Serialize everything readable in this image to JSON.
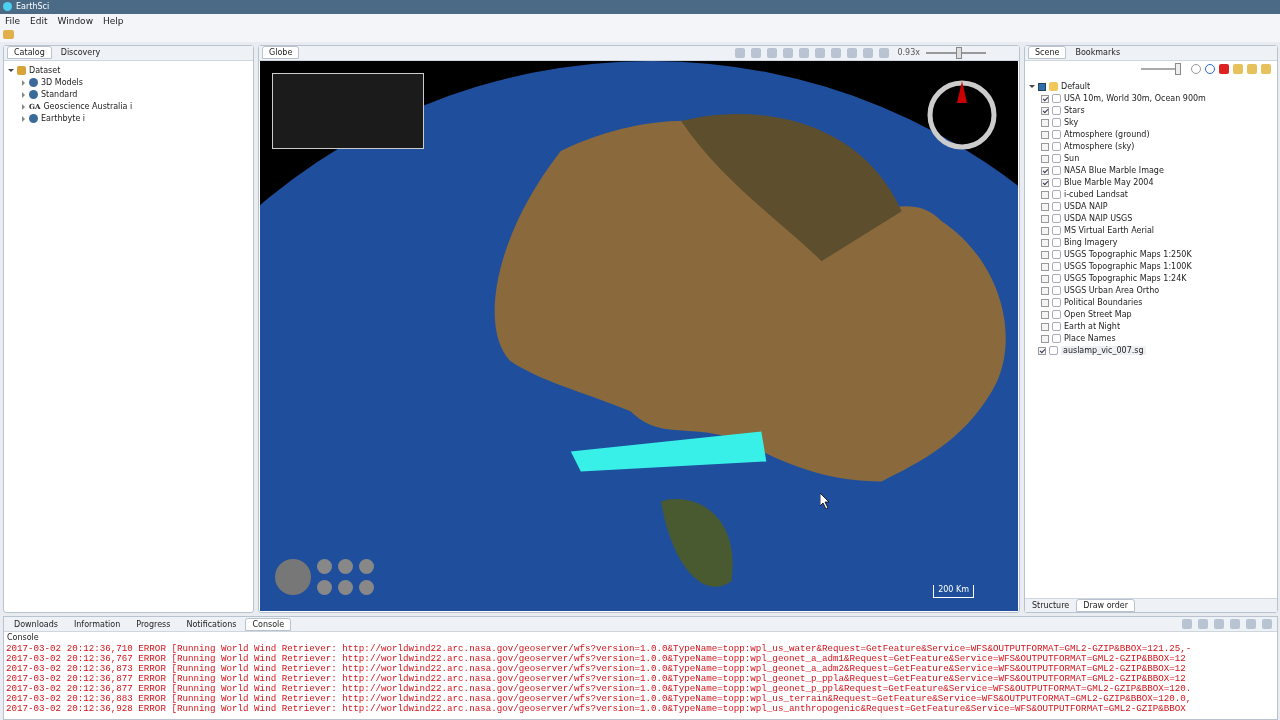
{
  "window": {
    "title": "EarthSci"
  },
  "menu": [
    "File",
    "Edit",
    "Window",
    "Help"
  ],
  "left_panel": {
    "tabs": [
      {
        "label": "Catalog",
        "selected": true
      },
      {
        "label": "Discovery",
        "selected": false
      }
    ],
    "tree": [
      {
        "label": "Dataset",
        "expanded": true,
        "children": [
          {
            "label": "3D Models",
            "expanded": false
          },
          {
            "label": "Standard",
            "expanded": false
          },
          {
            "label": "Geoscience Australia i",
            "expanded": false,
            "prefix": "GA"
          },
          {
            "label": "Earthbyte i",
            "expanded": false
          }
        ]
      }
    ]
  },
  "globe_panel": {
    "tab": {
      "label": "Globe",
      "selected": true
    },
    "zoom_reading": "0.93x",
    "zoom_slider": {
      "level": 0.55
    },
    "scale_label": "200 Km"
  },
  "scene_panel": {
    "tabs": [
      {
        "label": "Scene",
        "selected": true
      },
      {
        "label": "Bookmarks",
        "selected": false
      }
    ],
    "opacity_slider": {
      "level": 1
    },
    "tree": [
      {
        "label": "Default",
        "expanded": true,
        "checked": true,
        "children": [
          {
            "label": "USA 10m, World 30m, Ocean 900m",
            "checked": true
          },
          {
            "label": "Stars",
            "checked": true
          },
          {
            "label": "Sky",
            "checked": false
          },
          {
            "label": "Atmosphere (ground)",
            "checked": false
          },
          {
            "label": "Atmosphere (sky)",
            "checked": false
          },
          {
            "label": "Sun",
            "checked": false
          },
          {
            "label": "NASA Blue Marble Image",
            "checked": true
          },
          {
            "label": "Blue Marble May 2004",
            "checked": true
          },
          {
            "label": "i-cubed Landsat",
            "checked": false
          },
          {
            "label": "USDA NAIP",
            "checked": false
          },
          {
            "label": "USDA NAIP USGS",
            "checked": false
          },
          {
            "label": "MS Virtual Earth Aerial",
            "checked": false
          },
          {
            "label": "Bing Imagery",
            "checked": false
          },
          {
            "label": "USGS Topographic Maps 1:250K",
            "checked": false
          },
          {
            "label": "USGS Topographic Maps 1:100K",
            "checked": false
          },
          {
            "label": "USGS Topographic Maps 1:24K",
            "checked": false
          },
          {
            "label": "USGS Urban Area Ortho",
            "checked": false
          },
          {
            "label": "Political Boundaries",
            "checked": false
          },
          {
            "label": "Open Street Map",
            "checked": false
          },
          {
            "label": "Earth at Night",
            "checked": false
          },
          {
            "label": "Place Names",
            "checked": false
          }
        ]
      },
      {
        "label": "auslamp_vic_007.sg",
        "checked": true
      }
    ],
    "bottom_tabs": [
      {
        "label": "Structure",
        "selected": false
      },
      {
        "label": "Draw order",
        "selected": true
      }
    ]
  },
  "bottom_panel": {
    "tabs": [
      {
        "label": "Downloads",
        "selected": false
      },
      {
        "label": "Information",
        "selected": false
      },
      {
        "label": "Progress",
        "selected": false
      },
      {
        "label": "Notifications",
        "selected": false
      },
      {
        "label": "Console",
        "selected": true
      }
    ],
    "console_title": "Console",
    "lines": [
      "2017-03-02 20:12:36,710 ERROR [Running World Wind Retriever: http://worldwind22.arc.nasa.gov/geoserver/wfs?version=1.0.0&TypeName=topp:wpl_us_water&Request=GetFeature&Service=WFS&OUTPUTFORMAT=GML2-GZIP&BBOX=121.25,-",
      "2017-03-02 20:12:36,767 ERROR [Running World Wind Retriever: http://worldwind22.arc.nasa.gov/geoserver/wfs?version=1.0.0&TypeName=topp:wpl_geonet_a_adm1&Request=GetFeature&Service=WFS&OUTPUTFORMAT=GML2-GZIP&BBOX=12",
      "2017-03-02 20:12:36,873 ERROR [Running World Wind Retriever: http://worldwind22.arc.nasa.gov/geoserver/wfs?version=1.0.0&TypeName=topp:wpl_geonet_a_adm2&Request=GetFeature&Service=WFS&OUTPUTFORMAT=GML2-GZIP&BBOX=12",
      "2017-03-02 20:12:36,877 ERROR [Running World Wind Retriever: http://worldwind22.arc.nasa.gov/geoserver/wfs?version=1.0.0&TypeName=topp:wpl_geonet_p_ppla&Request=GetFeature&Service=WFS&OUTPUTFORMAT=GML2-GZIP&BBOX=12",
      "2017-03-02 20:12:36,877 ERROR [Running World Wind Retriever: http://worldwind22.arc.nasa.gov/geoserver/wfs?version=1.0.0&TypeName=topp:wpl_geonet_p_ppl&Request=GetFeature&Service=WFS&OUTPUTFORMAT=GML2-GZIP&BBOX=120.",
      "2017-03-02 20:12:36,883 ERROR [Running World Wind Retriever: http://worldwind22.arc.nasa.gov/geoserver/wfs?version=1.0.0&TypeName=topp:wpl_us_terrain&Request=GetFeature&Service=WFS&OUTPUTFORMAT=GML2-GZIP&BBOX=120.0,",
      "2017-03-02 20:12:36,928 ERROR [Running World Wind Retriever: http://worldwind22.arc.nasa.gov/geoserver/wfs?version=1.0.0&TypeName=topp:wpl_us_anthropogenic&Request=GetFeature&Service=WFS&OUTPUTFORMAT=GML2-GZIP&BBOX"
    ]
  }
}
